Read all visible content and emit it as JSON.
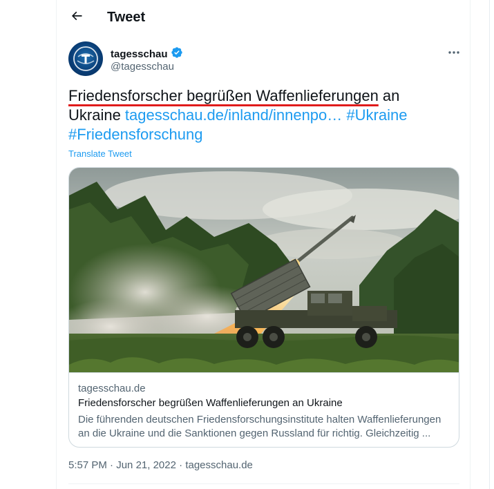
{
  "header": {
    "title": "Tweet",
    "back_icon": "arrow-left-icon"
  },
  "author": {
    "name": "tagesschau",
    "handle": "@tagesschau",
    "verified_icon": "verified-badge-icon",
    "more_icon": "more-horizontal-icon"
  },
  "tweet": {
    "text_highlighted": "Friedensforscher begrüßen Waffenlieferungen",
    "text_plain": " an Ukraine ",
    "link": "tagesschau.de/inland/innenpo…",
    "hashtag1": "#Ukraine",
    "hashtag2": "#Friedensforschung",
    "translate_label": "Translate Tweet"
  },
  "card": {
    "domain": "tagesschau.de",
    "title": "Friedensforscher begrüßen Waffenlieferungen an Ukraine",
    "description": "Die führenden deutschen Friedensforschungsinstitute halten Waffenlieferungen an die Ukraine und die Sanktionen gegen Russland für richtig. Gleichzeitig ..."
  },
  "meta": {
    "time": "5:57 PM",
    "separator": " · ",
    "date": "Jun 21, 2022",
    "source": "tagesschau.de"
  },
  "colors": {
    "accent": "#1d9bf0",
    "highlight_underline": "#e01b1b",
    "text_primary": "#0f1419",
    "text_secondary": "#536471",
    "border": "#cfd9de"
  }
}
